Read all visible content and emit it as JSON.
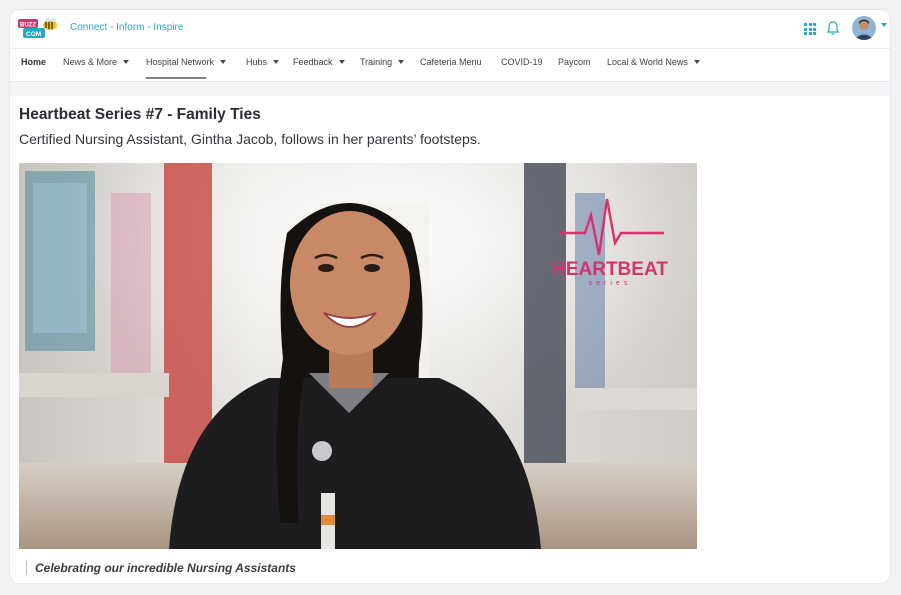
{
  "header": {
    "logo_text_top": "BUZZ",
    "logo_text_bottom": "COM",
    "tagline": "Connect - Inform - Inspire",
    "icons": [
      "apps-grid-icon",
      "bell-icon",
      "user-avatar"
    ]
  },
  "nav": {
    "items": [
      {
        "label": "Home",
        "has_dropdown": false
      },
      {
        "label": "News & More",
        "has_dropdown": true
      },
      {
        "label": "Hospital Network",
        "has_dropdown": true
      },
      {
        "label": "Hubs",
        "has_dropdown": true
      },
      {
        "label": "Feedback",
        "has_dropdown": true
      },
      {
        "label": "Training",
        "has_dropdown": true
      },
      {
        "label": "Cafeteria Menu",
        "has_dropdown": false
      },
      {
        "label": "COVID-19",
        "has_dropdown": false
      },
      {
        "label": "Paycom",
        "has_dropdown": false
      },
      {
        "label": "Local & World News",
        "has_dropdown": true
      }
    ],
    "active": "Hospital Network"
  },
  "article": {
    "title": "Heartbeat Series #7 - Family Ties",
    "subtitle": "Certified Nursing Assistant, Gintha Jacob, follows in her parents’ footsteps.",
    "hero_brand": "HEARTBEAT",
    "hero_brand_sub": "series",
    "caption": "Celebrating our incredible Nursing Assistants"
  },
  "colors": {
    "accent": "#2aa6c9",
    "heartbeat_pink": "#d6336e",
    "nav_text": "#3d3f44",
    "title_text": "#2b2d33"
  }
}
